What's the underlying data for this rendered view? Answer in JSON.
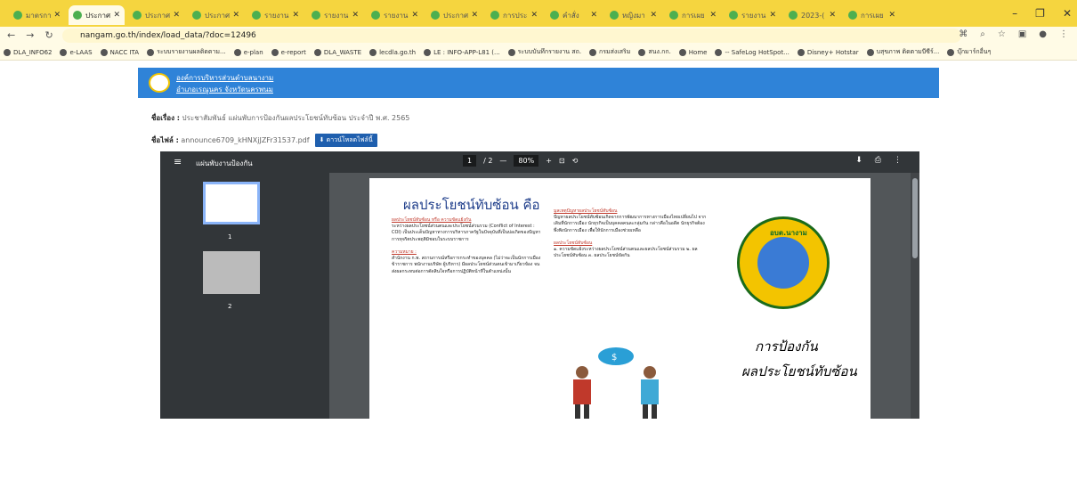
{
  "browser": {
    "tabs": [
      {
        "label": "มาตรการ",
        "active": false
      },
      {
        "label": "ประกาศ",
        "active": true
      },
      {
        "label": "ประกาศ",
        "active": false
      },
      {
        "label": "ประกาศ",
        "active": false
      },
      {
        "label": "รายงาน",
        "active": false
      },
      {
        "label": "รายงาน",
        "active": false
      },
      {
        "label": "รายงาน",
        "active": false
      },
      {
        "label": "ประกาศ",
        "active": false
      },
      {
        "label": "การประ",
        "active": false
      },
      {
        "label": "คำสั่ง",
        "active": false
      },
      {
        "label": "หญิงมา",
        "active": false
      },
      {
        "label": "การเผย",
        "active": false
      },
      {
        "label": "รายงาน",
        "active": false
      },
      {
        "label": "2023-(",
        "active": false
      },
      {
        "label": "การเผย",
        "active": false
      }
    ],
    "url": "nangam.go.th/index/load_data/?doc=12496",
    "bookmarks": [
      "DLA_INFO62",
      "e-LAAS",
      "NACC ITA",
      "ระบบรายงานผลติดตาม...",
      "e-plan",
      "e-report",
      "DLA_WASTE",
      "lecdla.go.th",
      "LE : INFO-APP-L81 (...",
      "ระบบบันทึกรายงาน สถ.",
      "กรมส่งเสริม",
      "สนง.กก.",
      "Home",
      "-- SafeLog HotSpot...",
      "Disney+ Hotstar",
      "บสุขภาพ ติดตามบีซีร์...",
      "บุ๊กมาร์กอื่นๆ"
    ]
  },
  "site": {
    "org_line1": "องค์การบริหารส่วนตำบลนางาม",
    "org_line2": "อำเภอเรณูนคร จังหวัดนครพนม"
  },
  "doc": {
    "subject_label": "ชื่อเรื่อง :",
    "subject": "ประชาสัมพันธ์ แผ่นพับการป้องกันผลประโยชน์ทับซ้อน ประจำปี พ.ศ. 2565",
    "file_label": "ชื่อไฟล์ :",
    "file_name": "announce6709_kHNXjJZFr31537.pdf",
    "download_label": "ดาวน์โหลดไฟล์นี้"
  },
  "viewer": {
    "title": "แผ่นพับงานป้องกัน",
    "page_current": "1",
    "page_total": "/ 2",
    "zoom": "80%",
    "thumb_numbers": [
      "1",
      "2"
    ]
  },
  "pdf_page": {
    "title": "ผลประโยชน์ทับซ้อน คือ",
    "colA_heading": "ผลประโยชน์ทับซ้อน หรือ ความขัดแย้งกัน",
    "colA_text": "ระหว่างผลประโยชน์ส่วนตนและประโยชน์ส่วนรวม (Conflict of Interest : COI) เป็นประเด็นปัญหาทางการบริหารภาครัฐในปัจจุบันที่เป็นบ่อเกิดของปัญหาการทุจริตประพฤติมิชอบในระบบราชการ",
    "colA_heading2": "ความหมาย :",
    "colA_text2": "สำนักงาน ก.พ. สถานการณ์หรือการกระทำของบุคคล (ไม่ว่าจะเป็นนักการเมือง ข้าราชการ พนักงานบริษัท ผู้บริหาร) มีผลประโยชน์ส่วนตนเข้ามาเกี่ยวข้อง จนส่งผลกระทบต่อการตัดสินใจหรือการปฏิบัติหน้าที่ในตำแหน่งนั้น",
    "colB_heading": "มูลเหตุปัญหาผลประโยชน์ทับซ้อน",
    "colB_text": "ปัญหาผลประโยชน์ทับซ้อนเกิดจากการพัฒนาการทางการเมืองไทยเปลี่ยนไป จากเดิมที่นักการเมือง นักธุรกิจเป็นบุคคลคนละกลุ่มกัน กล่าวคือในอดีต นักธุรกิจต้องพึ่งพิงนักการเมือง เพื่อให้นักการเมืองช่วยเหลือ",
    "colB_heading2": "ผลประโยชน์ทับซ้อน",
    "colB_list": "๑. ความขัดแย้งระหว่างผลประโยชน์ส่วนตนและผลประโยชน์ส่วนรวม ๒. ผลประโยชน์ทับซ้อน ๓. ผลประโยชน์ขัดกัน",
    "emblem_text": "อบต.นางาม",
    "big_title_1": "การป้องกัน",
    "big_title_2": "ผลประโยชน์ทับซ้อน",
    "figure_symbol": "$"
  }
}
